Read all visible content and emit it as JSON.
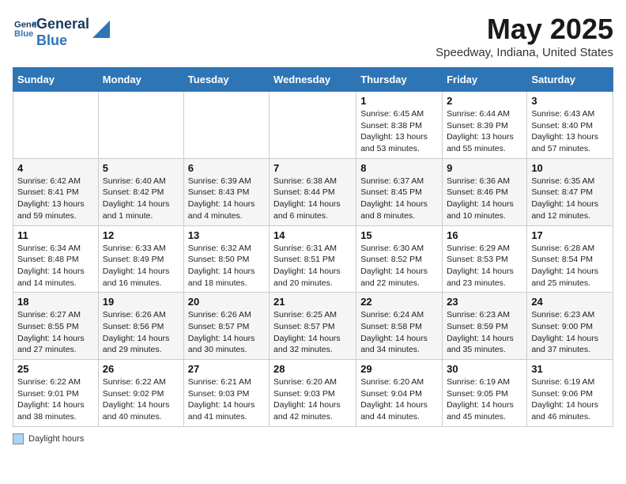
{
  "header": {
    "logo_line1": "General",
    "logo_line2": "Blue",
    "title": "May 2025",
    "subtitle": "Speedway, Indiana, United States"
  },
  "calendar": {
    "days_of_week": [
      "Sunday",
      "Monday",
      "Tuesday",
      "Wednesday",
      "Thursday",
      "Friday",
      "Saturday"
    ],
    "weeks": [
      [
        {
          "num": "",
          "detail": ""
        },
        {
          "num": "",
          "detail": ""
        },
        {
          "num": "",
          "detail": ""
        },
        {
          "num": "",
          "detail": ""
        },
        {
          "num": "1",
          "detail": "Sunrise: 6:45 AM\nSunset: 8:38 PM\nDaylight: 13 hours\nand 53 minutes."
        },
        {
          "num": "2",
          "detail": "Sunrise: 6:44 AM\nSunset: 8:39 PM\nDaylight: 13 hours\nand 55 minutes."
        },
        {
          "num": "3",
          "detail": "Sunrise: 6:43 AM\nSunset: 8:40 PM\nDaylight: 13 hours\nand 57 minutes."
        }
      ],
      [
        {
          "num": "4",
          "detail": "Sunrise: 6:42 AM\nSunset: 8:41 PM\nDaylight: 13 hours\nand 59 minutes."
        },
        {
          "num": "5",
          "detail": "Sunrise: 6:40 AM\nSunset: 8:42 PM\nDaylight: 14 hours\nand 1 minute."
        },
        {
          "num": "6",
          "detail": "Sunrise: 6:39 AM\nSunset: 8:43 PM\nDaylight: 14 hours\nand 4 minutes."
        },
        {
          "num": "7",
          "detail": "Sunrise: 6:38 AM\nSunset: 8:44 PM\nDaylight: 14 hours\nand 6 minutes."
        },
        {
          "num": "8",
          "detail": "Sunrise: 6:37 AM\nSunset: 8:45 PM\nDaylight: 14 hours\nand 8 minutes."
        },
        {
          "num": "9",
          "detail": "Sunrise: 6:36 AM\nSunset: 8:46 PM\nDaylight: 14 hours\nand 10 minutes."
        },
        {
          "num": "10",
          "detail": "Sunrise: 6:35 AM\nSunset: 8:47 PM\nDaylight: 14 hours\nand 12 minutes."
        }
      ],
      [
        {
          "num": "11",
          "detail": "Sunrise: 6:34 AM\nSunset: 8:48 PM\nDaylight: 14 hours\nand 14 minutes."
        },
        {
          "num": "12",
          "detail": "Sunrise: 6:33 AM\nSunset: 8:49 PM\nDaylight: 14 hours\nand 16 minutes."
        },
        {
          "num": "13",
          "detail": "Sunrise: 6:32 AM\nSunset: 8:50 PM\nDaylight: 14 hours\nand 18 minutes."
        },
        {
          "num": "14",
          "detail": "Sunrise: 6:31 AM\nSunset: 8:51 PM\nDaylight: 14 hours\nand 20 minutes."
        },
        {
          "num": "15",
          "detail": "Sunrise: 6:30 AM\nSunset: 8:52 PM\nDaylight: 14 hours\nand 22 minutes."
        },
        {
          "num": "16",
          "detail": "Sunrise: 6:29 AM\nSunset: 8:53 PM\nDaylight: 14 hours\nand 23 minutes."
        },
        {
          "num": "17",
          "detail": "Sunrise: 6:28 AM\nSunset: 8:54 PM\nDaylight: 14 hours\nand 25 minutes."
        }
      ],
      [
        {
          "num": "18",
          "detail": "Sunrise: 6:27 AM\nSunset: 8:55 PM\nDaylight: 14 hours\nand 27 minutes."
        },
        {
          "num": "19",
          "detail": "Sunrise: 6:26 AM\nSunset: 8:56 PM\nDaylight: 14 hours\nand 29 minutes."
        },
        {
          "num": "20",
          "detail": "Sunrise: 6:26 AM\nSunset: 8:57 PM\nDaylight: 14 hours\nand 30 minutes."
        },
        {
          "num": "21",
          "detail": "Sunrise: 6:25 AM\nSunset: 8:57 PM\nDaylight: 14 hours\nand 32 minutes."
        },
        {
          "num": "22",
          "detail": "Sunrise: 6:24 AM\nSunset: 8:58 PM\nDaylight: 14 hours\nand 34 minutes."
        },
        {
          "num": "23",
          "detail": "Sunrise: 6:23 AM\nSunset: 8:59 PM\nDaylight: 14 hours\nand 35 minutes."
        },
        {
          "num": "24",
          "detail": "Sunrise: 6:23 AM\nSunset: 9:00 PM\nDaylight: 14 hours\nand 37 minutes."
        }
      ],
      [
        {
          "num": "25",
          "detail": "Sunrise: 6:22 AM\nSunset: 9:01 PM\nDaylight: 14 hours\nand 38 minutes."
        },
        {
          "num": "26",
          "detail": "Sunrise: 6:22 AM\nSunset: 9:02 PM\nDaylight: 14 hours\nand 40 minutes."
        },
        {
          "num": "27",
          "detail": "Sunrise: 6:21 AM\nSunset: 9:03 PM\nDaylight: 14 hours\nand 41 minutes."
        },
        {
          "num": "28",
          "detail": "Sunrise: 6:20 AM\nSunset: 9:03 PM\nDaylight: 14 hours\nand 42 minutes."
        },
        {
          "num": "29",
          "detail": "Sunrise: 6:20 AM\nSunset: 9:04 PM\nDaylight: 14 hours\nand 44 minutes."
        },
        {
          "num": "30",
          "detail": "Sunrise: 6:19 AM\nSunset: 9:05 PM\nDaylight: 14 hours\nand 45 minutes."
        },
        {
          "num": "31",
          "detail": "Sunrise: 6:19 AM\nSunset: 9:06 PM\nDaylight: 14 hours\nand 46 minutes."
        }
      ]
    ]
  },
  "footer": {
    "legend_label": "Daylight hours"
  }
}
